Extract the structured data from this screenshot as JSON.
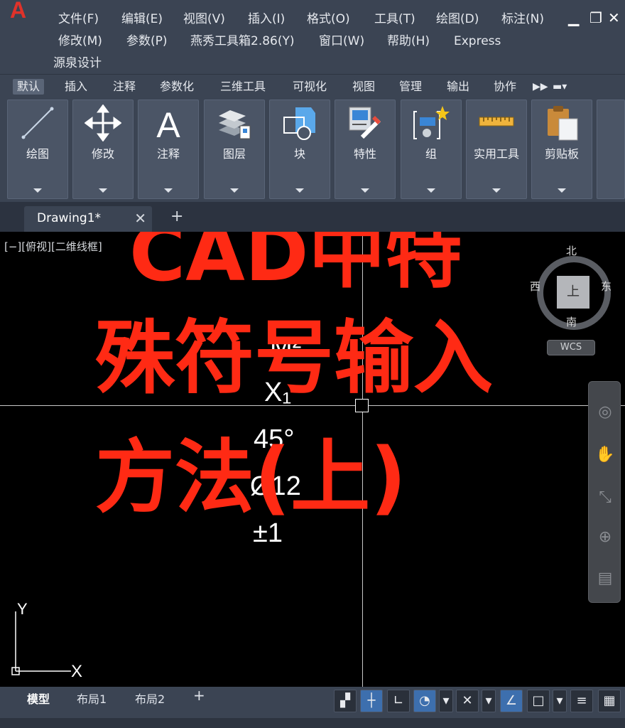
{
  "app": {
    "logo": "A"
  },
  "menu": {
    "row1": [
      "文件(F)",
      "编辑(E)",
      "视图(V)",
      "插入(I)",
      "格式(O)",
      "工具(T)",
      "绘图(D)",
      "标注(N)"
    ],
    "row2": [
      "修改(M)",
      "参数(P)",
      "燕秀工具箱2.86(Y)",
      "窗口(W)",
      "帮助(H)",
      "Express"
    ],
    "row3": [
      "源泉设计"
    ]
  },
  "ribbon_tabs": [
    "默认",
    "插入",
    "注释",
    "参数化",
    "三维工具",
    "可视化",
    "视图",
    "管理",
    "输出",
    "协作"
  ],
  "ribbon_panels": [
    "绘图",
    "修改",
    "注释",
    "图层",
    "块",
    "特性",
    "组",
    "实用工具",
    "剪贴板"
  ],
  "doc_tab": {
    "label": "Drawing1*",
    "close": "✕",
    "add": "+"
  },
  "viewport": {
    "label": "[−][俯视][二维线框]",
    "texts": {
      "superscript": "M²",
      "subscript": "X₁",
      "degree": "45°",
      "diameter": "Ø12",
      "plusminus": "±1"
    },
    "overlay": {
      "line1": "CAD中特",
      "line2": "殊符号输入",
      "line3": "方法(上)"
    },
    "viewcube": {
      "north": "北",
      "south": "南",
      "east": "东",
      "west": "西",
      "face": "上",
      "wcs": "WCS"
    },
    "ucs": {
      "x": "X",
      "y": "Y"
    }
  },
  "layout_tabs": [
    "模型",
    "布局1",
    "布局2"
  ],
  "layout_add": "+",
  "colors": {
    "accent": "#ff2a14",
    "chrome": "#3b4453",
    "panel": "#4b5566"
  }
}
